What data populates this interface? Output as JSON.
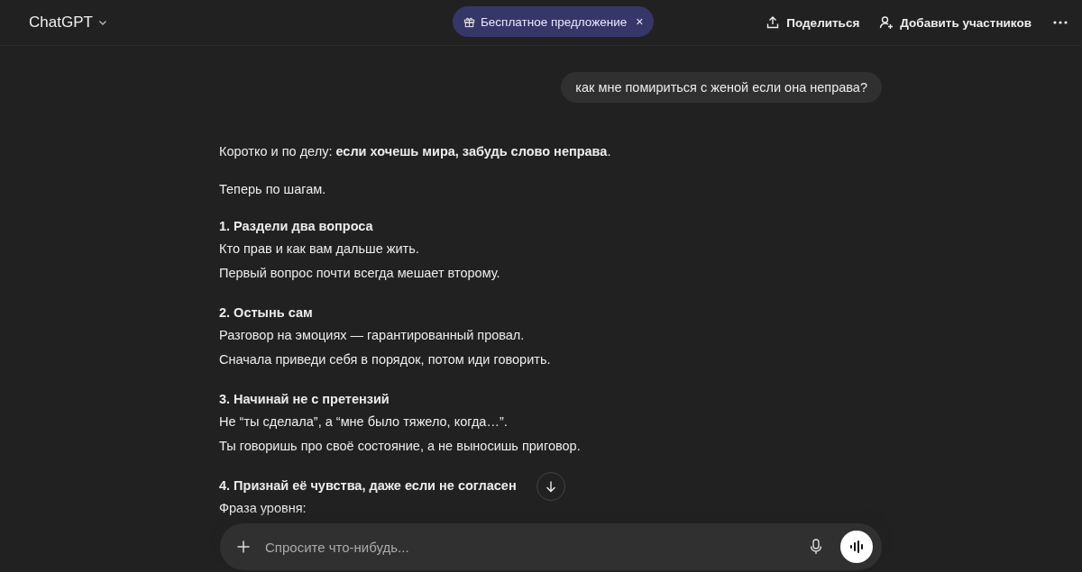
{
  "header": {
    "title": "ChatGPT",
    "offer": {
      "label": "Бесплатное предложение",
      "close": "×"
    },
    "share": "Поделиться",
    "add_people": "Добавить участников"
  },
  "user_message": "как мне помириться с женой если она неправа?",
  "answer": {
    "intro": "Коротко и по делу: **если хочешь мира, забудь слово неправа**.",
    "lead": "Теперь по шагам.",
    "steps": [
      {
        "title": "1. Раздели два вопроса",
        "lines": [
          "Кто прав и как вам дальше жить.",
          "Первый вопрос почти всегда мешает второму."
        ]
      },
      {
        "title": "2. Остынь сам",
        "lines": [
          "Разговор на эмоциях — гарантированный провал.",
          "Сначала приведи себя в порядок, потом иди говорить."
        ]
      },
      {
        "title": "3. Начинай не с претензий",
        "lines": [
          "Не “ты сделала”, а “мне было тяжело, когда…”.",
          "Ты говоришь про своё состояние, а не выносишь приговор."
        ]
      },
      {
        "title": "4. Признай её чувства, даже если не согласен",
        "lines": [
          "Фраза уровня:"
        ]
      }
    ]
  },
  "composer": {
    "placeholder": "Спросите что-нибудь..."
  }
}
